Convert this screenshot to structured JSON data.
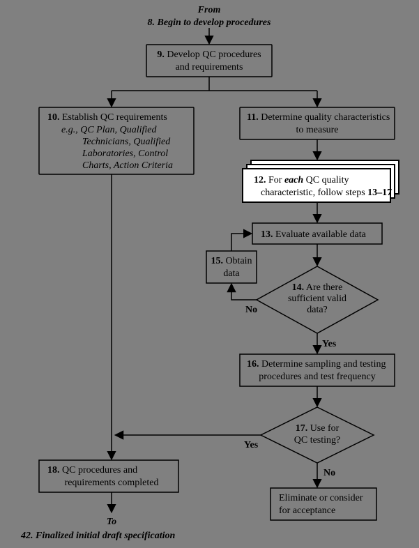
{
  "header": {
    "from": "From",
    "step8": "8. Begin to develop procedures"
  },
  "nodes": {
    "n9": {
      "num": "9.",
      "line1": "Develop QC procedures",
      "line2": "and requirements"
    },
    "n10": {
      "num": "10.",
      "line1": "Establish QC requirements",
      "eg": "e.g., QC Plan, Qualified",
      "l2": "Technicians, Qualified",
      "l3": "Laboratories, Control",
      "l4": "Charts, Action Criteria"
    },
    "n11": {
      "num": "11.",
      "line1": "Determine quality characteristics",
      "line2": "to measure"
    },
    "n12": {
      "num": "12.",
      "each": "each",
      "line1a": "For ",
      "line1b": " QC quality",
      "line2": "characteristic, follow steps ",
      "range": "13–17"
    },
    "n13": {
      "num": "13.",
      "line1": "Evaluate available data"
    },
    "n14": {
      "num": "14.",
      "line1": "Are there",
      "line2": "sufficient valid",
      "line3": "data?"
    },
    "n15": {
      "num": "15.",
      "line1": "Obtain",
      "line2": "data"
    },
    "n16": {
      "num": "16.",
      "line1": "Determine sampling and testing",
      "line2": "procedures and test frequency"
    },
    "n17": {
      "num": "17.",
      "line1": "Use for",
      "line2": "QC testing?"
    },
    "n18": {
      "num": "18.",
      "line1": "QC procedures and",
      "line2": "requirements completed"
    },
    "elim": {
      "line1": "Eliminate or consider",
      "line2": "for acceptance"
    }
  },
  "labels": {
    "yes": "Yes",
    "no": "No"
  },
  "footer": {
    "to": "To",
    "step42": "42. Finalized initial draft specification"
  }
}
